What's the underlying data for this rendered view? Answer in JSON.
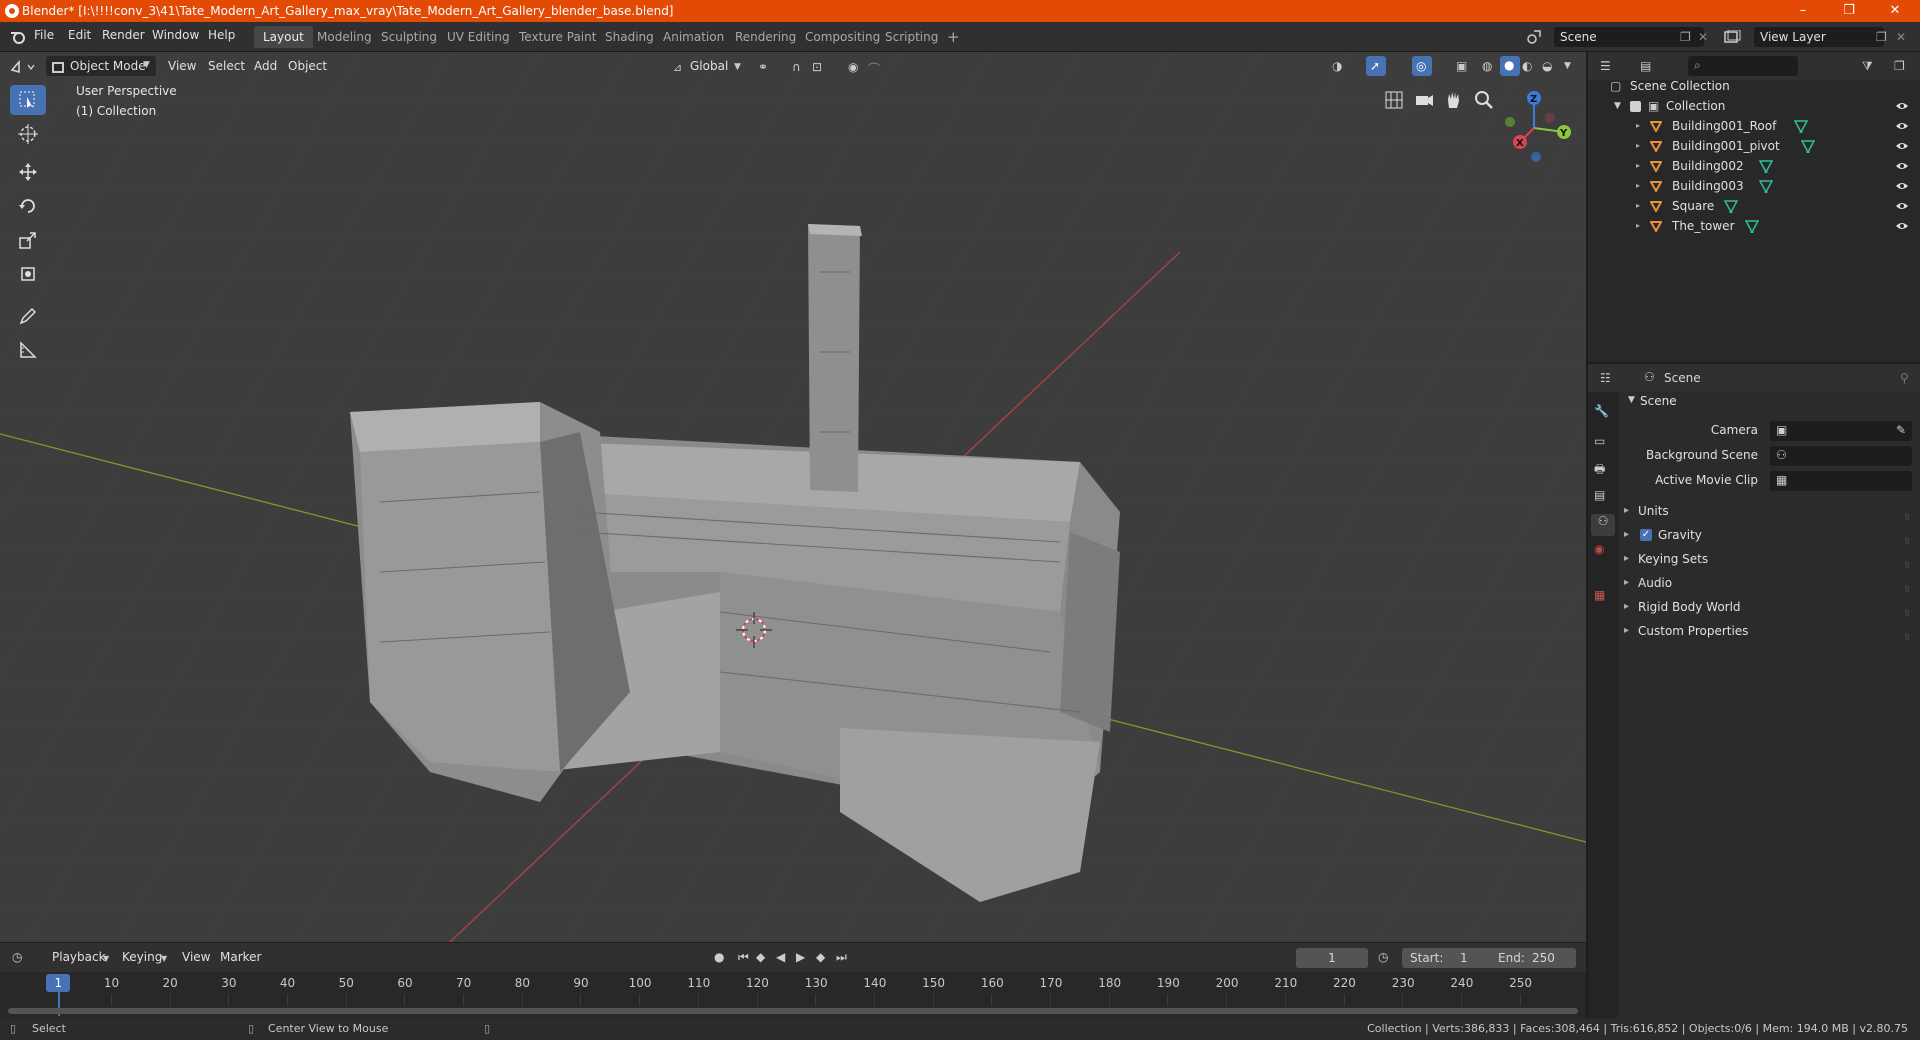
{
  "window": {
    "title": "Blender* [I:\\!!!!conv_3\\41\\Tate_Modern_Art_Gallery_max_vray\\Tate_Modern_Art_Gallery_blender_base.blend]",
    "minimize": "–",
    "maximize": "❐",
    "close": "✕"
  },
  "menu": [
    "File",
    "Edit",
    "Render",
    "Window",
    "Help"
  ],
  "workspaces": [
    "Layout",
    "Modeling",
    "Sculpting",
    "UV Editing",
    "Texture Paint",
    "Shading",
    "Animation",
    "Rendering",
    "Compositing",
    "Scripting"
  ],
  "workspace_add": "+",
  "active_workspace": "Layout",
  "scene_field": "Scene",
  "view_layer_field": "View Layer",
  "viewport_header": {
    "mode": "Object Mode",
    "view": "View",
    "select": "Select",
    "add": "Add",
    "object": "Object",
    "transform": "Global"
  },
  "viewport": {
    "perspective": "User Perspective",
    "collection": "(1) Collection"
  },
  "gizmo": {
    "x": "X",
    "y": "Y",
    "z": "Z"
  },
  "outliner": {
    "root": "Scene Collection",
    "collection": "Collection",
    "objects": [
      "Building001_Roof",
      "Building001_pivot",
      "Building002",
      "Building003",
      "Square",
      "The_tower"
    ]
  },
  "properties": {
    "header": "Scene",
    "section": "Scene",
    "fields": [
      {
        "label": "Camera"
      },
      {
        "label": "Background Scene"
      },
      {
        "label": "Active Movie Clip"
      }
    ],
    "panels": [
      "Units",
      "Gravity",
      "Keying Sets",
      "Audio",
      "Rigid Body World",
      "Custom Properties"
    ]
  },
  "timeline": {
    "playback": "Playback",
    "keying": "Keying",
    "view": "View",
    "marker": "Marker",
    "current_frame": "1",
    "start_label": "Start:",
    "start": "1",
    "end_label": "End:",
    "end": "250",
    "ticks": [
      "1",
      "10",
      "20",
      "30",
      "40",
      "50",
      "60",
      "70",
      "80",
      "90",
      "100",
      "110",
      "120",
      "130",
      "140",
      "150",
      "160",
      "170",
      "180",
      "190",
      "200",
      "210",
      "220",
      "230",
      "240",
      "250"
    ]
  },
  "status": {
    "select": "Select",
    "center_view": "Center View to Mouse",
    "stats": "Collection | Verts:386,833 | Faces:308,464 | Tris:616,852 | Objects:0/6 | Mem: 194.0 MB | v2.80.75"
  },
  "colors": {
    "titlebar": "#e34a06",
    "active_tool": "#4772b3",
    "x_axis": "#d94552",
    "y_axis": "#8cc63f",
    "z_axis": "#3b7bd9",
    "object_icon": "#e8913a",
    "mesh_icon": "#2fbf9a"
  }
}
